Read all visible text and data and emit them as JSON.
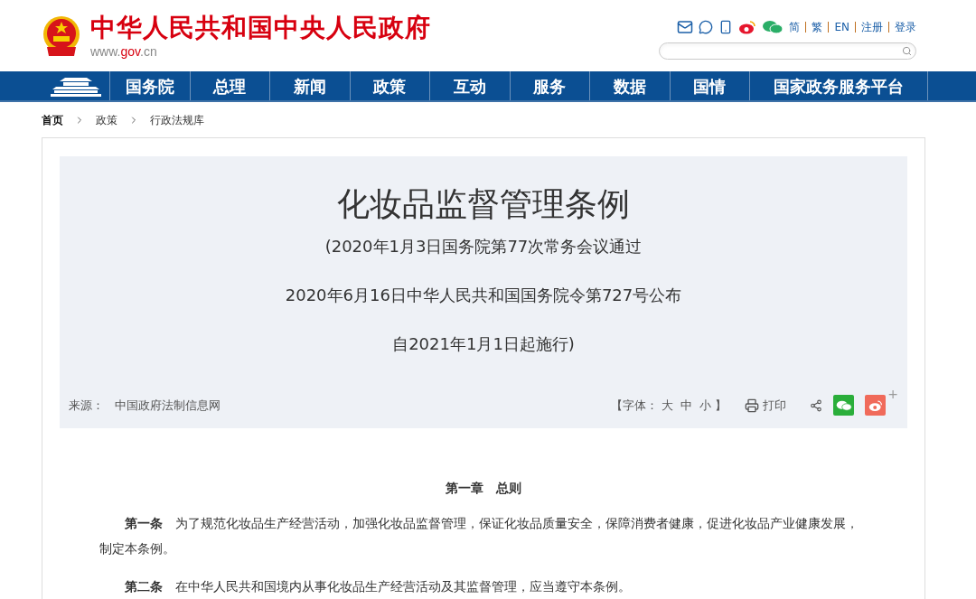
{
  "header": {
    "site_title": "中华人民共和国中央人民政府",
    "site_url_prefix": "www.",
    "site_url_domain": "gov",
    "site_url_suffix": ".cn",
    "links": [
      "简",
      "繁",
      "EN",
      "注册",
      "登录"
    ]
  },
  "nav": [
    "国务院",
    "总理",
    "新闻",
    "政策",
    "互动",
    "服务",
    "数据",
    "国情",
    "国家政务服务平台"
  ],
  "breadcrumb": [
    "首页",
    "政策",
    "行政法规库"
  ],
  "article": {
    "title": "化妆品监督管理条例",
    "subtitles": [
      "(2020年1月3日国务院第77次常务会议通过",
      "2020年6月16日中华人民共和国国务院令第727号公布",
      "自2021年1月1日起施行)"
    ],
    "source_label": "来源：",
    "source": "中国政府法制信息网",
    "font_open": "【字体：",
    "font_sizes": [
      "大",
      "中",
      "小"
    ],
    "font_close": "】",
    "print": "打印",
    "share_more": "+",
    "chapter": "第一章　总则",
    "paragraphs": [
      "**第一条**　为了规范化妆品生产经营活动，加强化妆品监督管理，保证化妆品质量安全，保障消费者健康，促进化妆品产业健康发展，制定本条例。",
      "**第二条**　在中华人民共和国境内从事化妆品生产经营活动及其监督管理，应当遵守本条例。"
    ]
  }
}
